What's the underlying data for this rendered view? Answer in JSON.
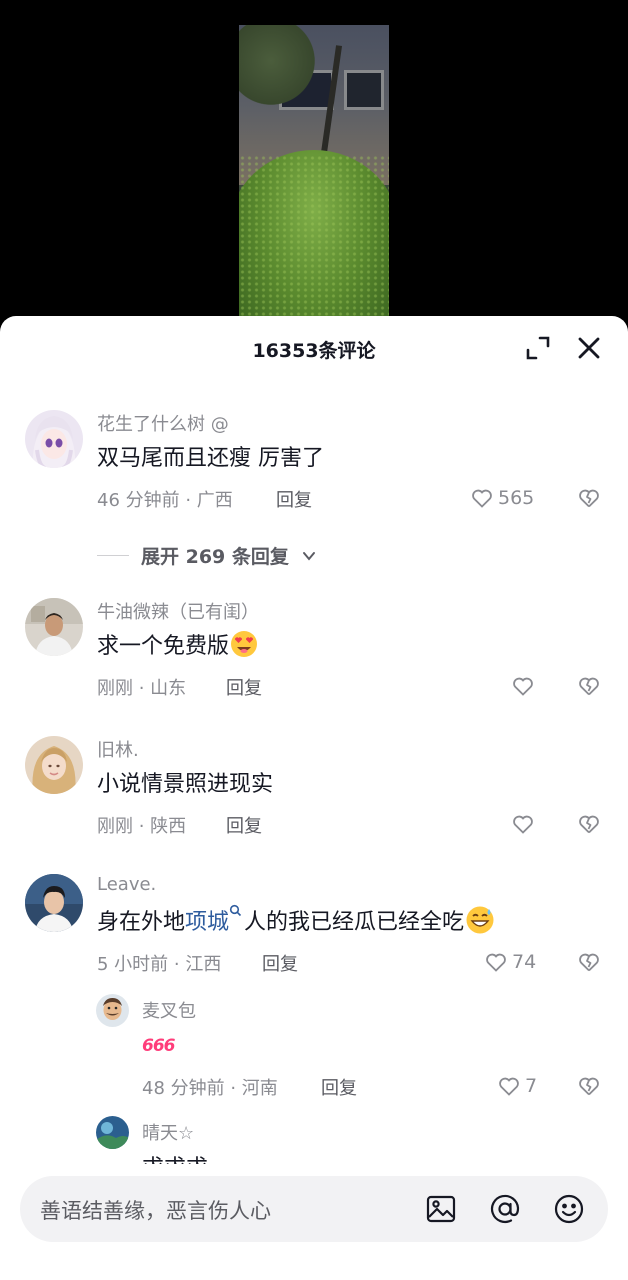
{
  "sheet": {
    "title": "16353条评论"
  },
  "comments": [
    {
      "username": "花生了什么树 @",
      "content": "双马尾而且还瘦 厉害了",
      "meta": "46 分钟前 · 广西",
      "reply": "回复",
      "likes": "565",
      "expand": "展开 269 条回复"
    },
    {
      "username": "牛油微辣（已有闺）",
      "content": "求一个免费版",
      "meta": "刚刚 · 山东",
      "reply": "回复",
      "likes": ""
    },
    {
      "username": "旧林.",
      "content": "小说情景照进现实",
      "meta": "刚刚 · 陕西",
      "reply": "回复",
      "likes": ""
    },
    {
      "username": "Leave.",
      "content_pre": "身在外地",
      "content_tag": "项城",
      "content_post": "人的我已经瓜已经全吃",
      "meta": "5 小时前 · 江西",
      "reply": "回复",
      "likes": "74"
    }
  ],
  "replies": [
    {
      "username": "麦叉包",
      "content": "666",
      "meta": "48 分钟前 · 河南",
      "reply": "回复",
      "likes": "7"
    },
    {
      "username": "晴天☆",
      "content": "求求求"
    }
  ],
  "input": {
    "placeholder": "善语结善缘，恶言伤人心"
  },
  "colors": {
    "accent_link": "#2e5c9e",
    "text_primary": "#161823",
    "text_secondary": "#8a8b91"
  }
}
